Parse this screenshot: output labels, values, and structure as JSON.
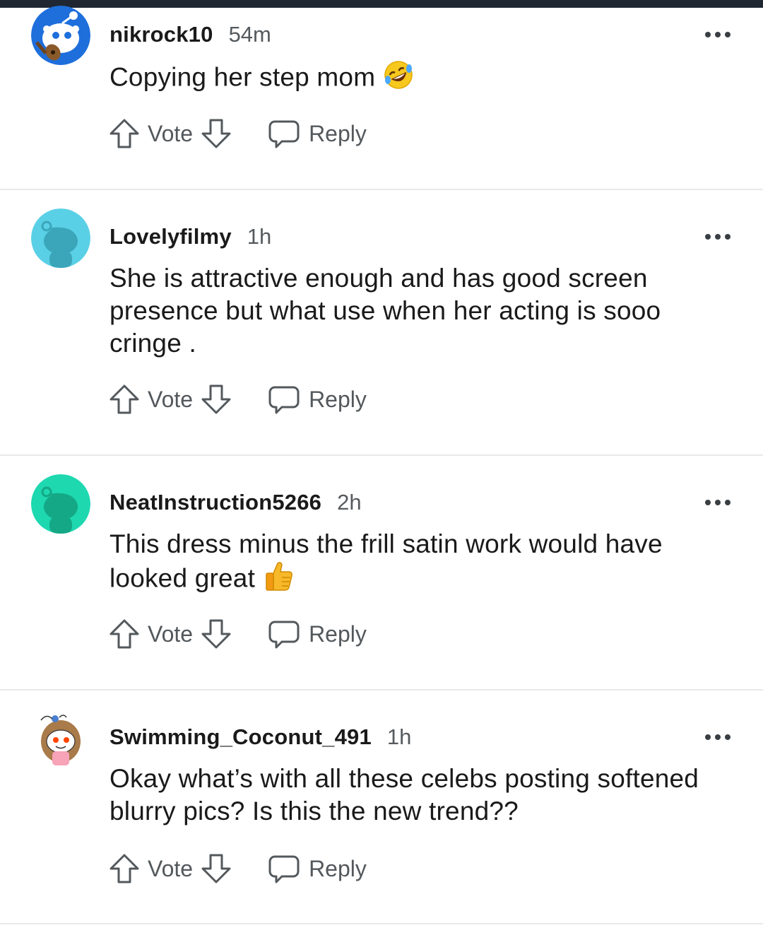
{
  "comments": [
    {
      "username": "nikrock10",
      "time": "54m",
      "text": "Copying her step mom",
      "emoji": "rolling-on-floor-laughing",
      "avatar_color": "#1e6fdc",
      "vote_label": "Vote",
      "reply_label": "Reply"
    },
    {
      "username": "Lovelyfilmy",
      "time": "1h",
      "text": "She is attractive enough and has good screen presence but what use when her acting is sooo cringe .",
      "avatar_color": "#5ad0e6",
      "vote_label": "Vote",
      "reply_label": "Reply"
    },
    {
      "username": "NeatInstruction5266",
      "time": "2h",
      "text": "This dress minus the frill satin work would have looked great",
      "emoji": "thumbs-up",
      "avatar_color": "#1ed8b0",
      "vote_label": "Vote",
      "reply_label": "Reply"
    },
    {
      "username": "Swimming_Coconut_491",
      "time": "1h",
      "text": "Okay what’s with all these celebs posting softened blurry pics? Is this the new trend??",
      "avatar_color": "#ffffff",
      "vote_label": "Vote",
      "reply_label": "Reply"
    }
  ]
}
